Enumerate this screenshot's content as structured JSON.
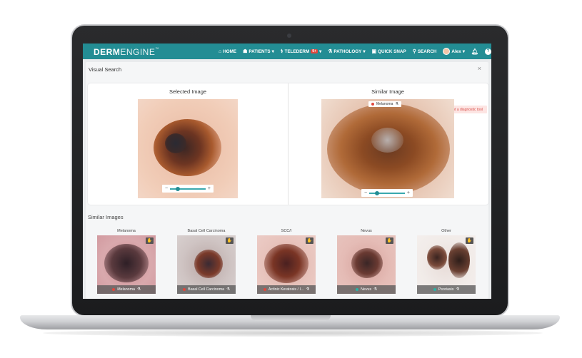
{
  "app": {
    "logo_main": "DERM",
    "logo_rest": "ENGINE",
    "logo_tm": "™"
  },
  "nav": {
    "home": "HOME",
    "patients": "PATIENTS",
    "telederm": "TELEDERM",
    "telederm_badge": "9+",
    "pathology": "PATHOLOGY",
    "quick_snap": "QUICK SNAP",
    "search": "SEARCH",
    "user": "Alex"
  },
  "dialog": {
    "title": "Visual Search",
    "close": "×",
    "warning": "Not a diagnostic tool",
    "selected_title": "Selected Image",
    "similar_title": "Similar Image",
    "similar_tag": "Melanoma",
    "zoom_minus": "−",
    "zoom_plus": "+"
  },
  "similar_images": {
    "title": "Similar Images",
    "items": [
      {
        "category": "Melanoma",
        "label": "Melanoma",
        "dot_color": "#e0473d"
      },
      {
        "category": "Basal Cell Carcinoma",
        "label": "Basal Cell Carcinoma",
        "dot_color": "#e0473d"
      },
      {
        "category": "SCC/I",
        "label": "Actinic Keratosis / I...",
        "dot_color": "#e0473d"
      },
      {
        "category": "Nevus",
        "label": "Nevus",
        "dot_color": "#2ab3a6"
      },
      {
        "category": "Other",
        "label": "Psoriasis",
        "dot_color": "#2ab3a6"
      }
    ]
  },
  "colors": {
    "brand": "#238d94",
    "warning": "#d9534f"
  }
}
